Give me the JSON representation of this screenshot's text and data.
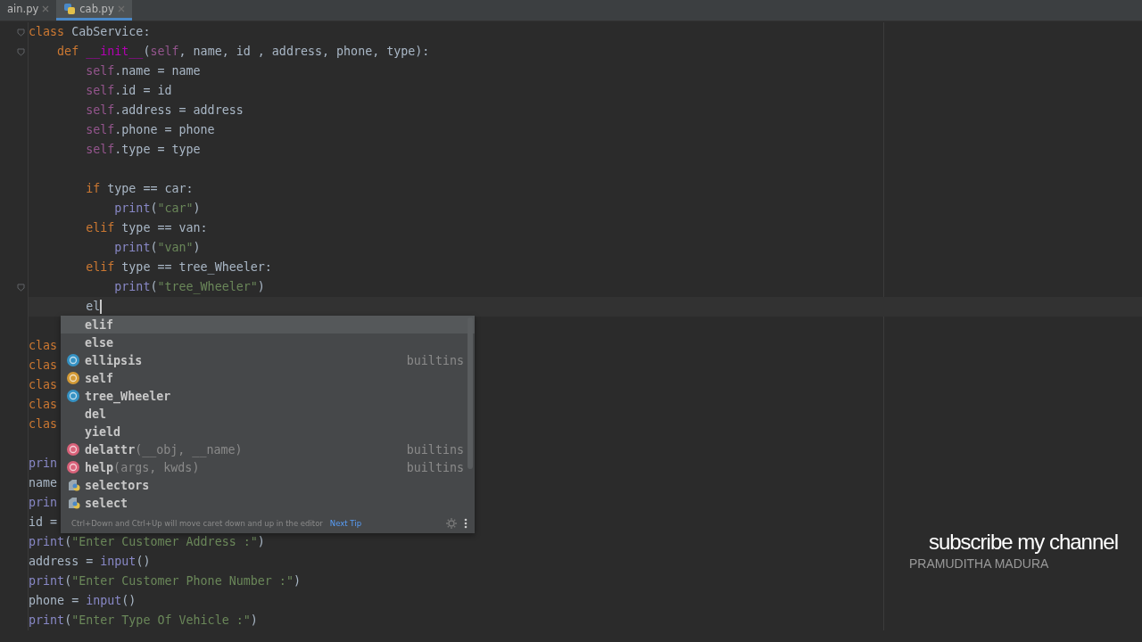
{
  "tabs": [
    {
      "label": "ain.py",
      "kind": "plain",
      "selected": false
    },
    {
      "label": "cab.py",
      "kind": "python",
      "selected": true
    }
  ],
  "editor": {
    "lines": [
      {
        "kind": "code",
        "current": false,
        "fold": true,
        "tokens": [
          {
            "text": "class",
            "kind": "kw"
          },
          {
            "text": " CabService:",
            "kind": "plain"
          }
        ]
      },
      {
        "kind": "code",
        "current": false,
        "fold": true,
        "tokens": [
          {
            "text": "    def",
            "kind": "kw"
          },
          {
            "text": " __init__",
            "kind": "magic"
          },
          {
            "text": "(",
            "kind": "plain"
          },
          {
            "text": "self",
            "kind": "self"
          },
          {
            "text": ", name, id , address, phone, type):",
            "kind": "plain"
          }
        ]
      },
      {
        "kind": "code",
        "current": false,
        "fold": false,
        "tokens": [
          {
            "text": "        self",
            "kind": "self"
          },
          {
            "text": ".name = name",
            "kind": "plain"
          }
        ]
      },
      {
        "kind": "code",
        "current": false,
        "fold": false,
        "tokens": [
          {
            "text": "        self",
            "kind": "self"
          },
          {
            "text": ".id = id",
            "kind": "plain"
          }
        ]
      },
      {
        "kind": "code",
        "current": false,
        "fold": false,
        "tokens": [
          {
            "text": "        self",
            "kind": "self"
          },
          {
            "text": ".address = address",
            "kind": "plain"
          }
        ]
      },
      {
        "kind": "code",
        "current": false,
        "fold": false,
        "tokens": [
          {
            "text": "        self",
            "kind": "self"
          },
          {
            "text": ".phone = phone",
            "kind": "plain"
          }
        ]
      },
      {
        "kind": "code",
        "current": false,
        "fold": false,
        "tokens": [
          {
            "text": "        self",
            "kind": "self"
          },
          {
            "text": ".type = type",
            "kind": "plain"
          }
        ]
      },
      {
        "kind": "blank"
      },
      {
        "kind": "code",
        "current": false,
        "fold": false,
        "tokens": [
          {
            "text": "        if",
            "kind": "kw"
          },
          {
            "text": " type == car:",
            "kind": "plain"
          }
        ]
      },
      {
        "kind": "code",
        "current": false,
        "fold": false,
        "tokens": [
          {
            "text": "            print",
            "kind": "builtin"
          },
          {
            "text": "(",
            "kind": "plain"
          },
          {
            "text": "\"car\"",
            "kind": "str"
          },
          {
            "text": ")",
            "kind": "plain"
          }
        ]
      },
      {
        "kind": "code",
        "current": false,
        "fold": false,
        "tokens": [
          {
            "text": "        elif",
            "kind": "kw"
          },
          {
            "text": " type == van:",
            "kind": "plain"
          }
        ]
      },
      {
        "kind": "code",
        "current": false,
        "fold": false,
        "tokens": [
          {
            "text": "            print",
            "kind": "builtin"
          },
          {
            "text": "(",
            "kind": "plain"
          },
          {
            "text": "\"van\"",
            "kind": "str"
          },
          {
            "text": ")",
            "kind": "plain"
          }
        ]
      },
      {
        "kind": "code",
        "current": false,
        "fold": false,
        "tokens": [
          {
            "text": "        elif",
            "kind": "kw"
          },
          {
            "text": " type == tree_Wheeler:",
            "kind": "plain"
          }
        ]
      },
      {
        "kind": "code",
        "current": false,
        "fold": true,
        "tokens": [
          {
            "text": "            print",
            "kind": "builtin"
          },
          {
            "text": "(",
            "kind": "plain"
          },
          {
            "text": "\"tree_Wheeler\"",
            "kind": "str"
          },
          {
            "text": ")",
            "kind": "plain"
          }
        ]
      },
      {
        "kind": "code",
        "current": true,
        "fold": false,
        "tokens": [
          {
            "text": "        el",
            "kind": "plain"
          }
        ]
      },
      {
        "kind": "blank"
      },
      {
        "kind": "code",
        "current": false,
        "fold": false,
        "tokens": [
          {
            "text": "clas",
            "kind": "kw"
          }
        ]
      },
      {
        "kind": "code",
        "current": false,
        "fold": false,
        "tokens": [
          {
            "text": "clas",
            "kind": "kw"
          }
        ]
      },
      {
        "kind": "code",
        "current": false,
        "fold": false,
        "tokens": [
          {
            "text": "clas",
            "kind": "kw"
          }
        ]
      },
      {
        "kind": "code",
        "current": false,
        "fold": false,
        "tokens": [
          {
            "text": "clas",
            "kind": "kw"
          }
        ]
      },
      {
        "kind": "code",
        "current": false,
        "fold": false,
        "tokens": [
          {
            "text": "clas",
            "kind": "kw"
          }
        ]
      },
      {
        "kind": "blank"
      },
      {
        "kind": "code",
        "current": false,
        "fold": false,
        "tokens": [
          {
            "text": "prin",
            "kind": "builtin"
          }
        ]
      },
      {
        "kind": "code",
        "current": false,
        "fold": false,
        "tokens": [
          {
            "text": "name",
            "kind": "plain"
          }
        ]
      },
      {
        "kind": "code",
        "current": false,
        "fold": false,
        "tokens": [
          {
            "text": "prin",
            "kind": "builtin"
          }
        ]
      },
      {
        "kind": "code",
        "current": false,
        "fold": false,
        "tokens": [
          {
            "text": "id =",
            "kind": "plain"
          }
        ]
      },
      {
        "kind": "code",
        "current": false,
        "fold": false,
        "tokens": [
          {
            "text": "print",
            "kind": "builtin"
          },
          {
            "text": "(",
            "kind": "plain"
          },
          {
            "text": "\"Enter Customer Address :\"",
            "kind": "str"
          },
          {
            "text": ")",
            "kind": "plain"
          }
        ]
      },
      {
        "kind": "code",
        "current": false,
        "fold": false,
        "tokens": [
          {
            "text": "address = ",
            "kind": "plain"
          },
          {
            "text": "input",
            "kind": "builtin"
          },
          {
            "text": "()",
            "kind": "plain"
          }
        ]
      },
      {
        "kind": "code",
        "current": false,
        "fold": false,
        "tokens": [
          {
            "text": "print",
            "kind": "builtin"
          },
          {
            "text": "(",
            "kind": "plain"
          },
          {
            "text": "\"Enter Customer Phone Number :\"",
            "kind": "str"
          },
          {
            "text": ")",
            "kind": "plain"
          }
        ]
      },
      {
        "kind": "code",
        "current": false,
        "fold": false,
        "tokens": [
          {
            "text": "phone = ",
            "kind": "plain"
          },
          {
            "text": "input",
            "kind": "builtin"
          },
          {
            "text": "()",
            "kind": "plain"
          }
        ]
      },
      {
        "kind": "code",
        "current": false,
        "fold": false,
        "tokens": [
          {
            "text": "print",
            "kind": "builtin"
          },
          {
            "text": "(",
            "kind": "plain"
          },
          {
            "text": "\"Enter Type Of Vehicle :\"",
            "kind": "str"
          },
          {
            "text": ")",
            "kind": "plain"
          }
        ]
      }
    ]
  },
  "completion": {
    "items": [
      {
        "label": "elif",
        "kind": "keyword",
        "selected": true
      },
      {
        "label": "else",
        "kind": "keyword",
        "selected": false
      },
      {
        "label": "ellipsis",
        "kind": "class",
        "hint": "builtins",
        "selected": false
      },
      {
        "label": "self",
        "kind": "param",
        "selected": false
      },
      {
        "label": "tree_Wheeler",
        "kind": "class",
        "selected": false
      },
      {
        "label": "del",
        "kind": "keyword",
        "selected": false
      },
      {
        "label": "yield",
        "kind": "keyword",
        "selected": false
      },
      {
        "label": "delattr",
        "signature": "(__obj, __name)",
        "kind": "function",
        "hint": "builtins",
        "selected": false
      },
      {
        "label": "help",
        "signature": "(args, kwds)",
        "kind": "function",
        "hint": "builtins",
        "selected": false
      },
      {
        "label": "selectors",
        "kind": "module",
        "selected": false
      },
      {
        "label": "select",
        "kind": "module",
        "selected": false
      }
    ],
    "tip": "Ctrl+Down and Ctrl+Up will move caret down and up in the editor",
    "tip_link": "Next Tip"
  },
  "caption": {
    "title": "subscribe my channel",
    "author": "PRAMUDITHA MADURA"
  }
}
